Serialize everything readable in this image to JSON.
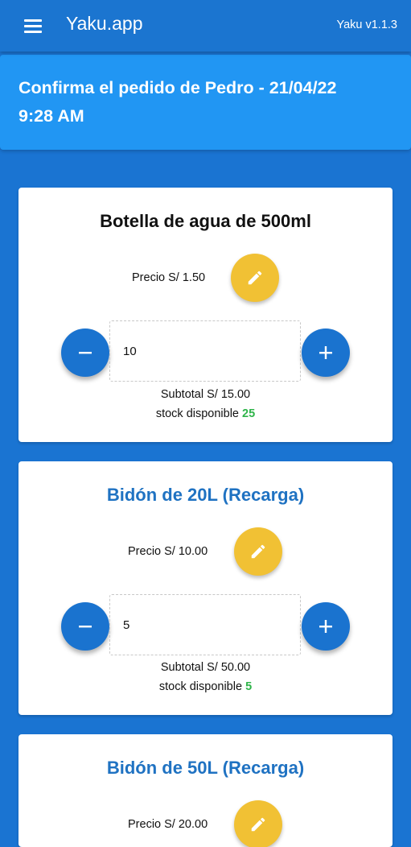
{
  "appbar": {
    "title": "Yaku.app",
    "version": "Yaku v1.1.3"
  },
  "banner": {
    "text": "Confirma el pedido de Pedro - 21/04/22 9:28 AM"
  },
  "products": [
    {
      "name": "Botella de agua de 500ml",
      "price": "Precio S/ 1.50",
      "quantity": "10",
      "subtotal": "Subtotal S/ 15.00",
      "stock_label": "stock disponible",
      "stock": "25"
    },
    {
      "name": "Bidón de 20L (Recarga)",
      "price": "Precio S/ 10.00",
      "quantity": "5",
      "subtotal": "Subtotal S/ 50.00",
      "stock_label": "stock disponible",
      "stock": "5"
    },
    {
      "name": "Bidón de 50L (Recarga)",
      "price": "Precio S/ 20.00"
    }
  ],
  "colors": {
    "primary": "#1b75d0",
    "banner": "#2196f3",
    "accent": "#f1c134",
    "stock": "#2fb44a",
    "title_active": "#1f72c2"
  },
  "icons": [
    "menu-icon",
    "pencil-icon",
    "minus-icon",
    "plus-icon"
  ]
}
